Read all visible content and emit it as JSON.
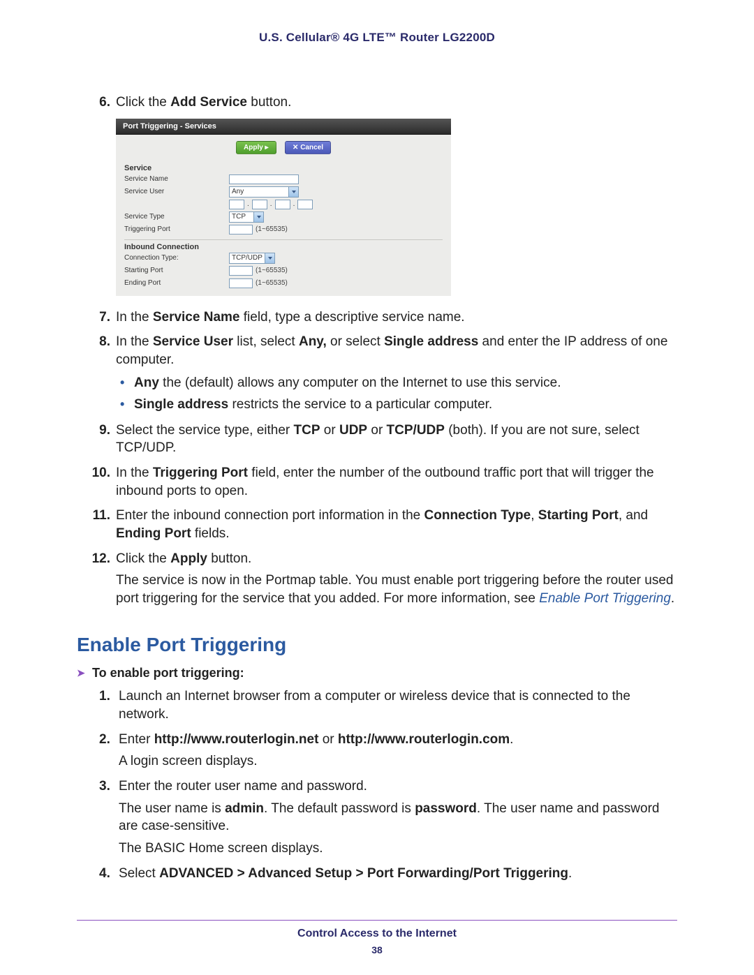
{
  "header": {
    "title": "U.S. Cellular® 4G LTE™ Router LG2200D"
  },
  "steps6to12": {
    "s6": {
      "num": "6.",
      "pre": "Click the ",
      "b": "Add Service",
      "post": " button."
    },
    "s7": {
      "num": "7.",
      "pre": "In the ",
      "b": "Service Name",
      "post": " field, type a descriptive service name."
    },
    "s8": {
      "num": "8.",
      "pre": "In the ",
      "b1": "Service User",
      "mid1": " list, select ",
      "b2": "Any,",
      "mid2": " or select ",
      "b3": "Single address",
      "post": " and enter the IP address of one computer.",
      "bullets": [
        {
          "b": "Any",
          "t": " the (default) allows any computer on the Internet to use this service."
        },
        {
          "b": "Single address",
          "t": " restricts the service to a particular computer."
        }
      ]
    },
    "s9": {
      "num": "9.",
      "pre": "Select the service type, either ",
      "b1": "TCP",
      "mid1": " or ",
      "b2": "UDP",
      "mid2": " or ",
      "b3": "TCP/UDP",
      "post": " (both). If you are not sure, select TCP/UDP."
    },
    "s10": {
      "num": "10.",
      "pre": "In the ",
      "b": "Triggering Port",
      "post": " field, enter the number of the outbound traffic port that will trigger the inbound ports to open."
    },
    "s11": {
      "num": "11.",
      "pre": "Enter the inbound connection port information in the ",
      "b1": "Connection Type",
      "mid1": ", ",
      "b2": "Starting Port",
      "mid2": ", and ",
      "b3": "Ending Port",
      "post": " fields."
    },
    "s12": {
      "num": "12.",
      "pre": "Click the ",
      "b": "Apply",
      "post": " button.",
      "tail_pre": "The service is now in the Portmap table. You must enable port triggering before the router used port triggering for the service that you added. For more information, see ",
      "link": "Enable Port Triggering",
      "tail_post": "."
    }
  },
  "section": {
    "heading": "Enable Port Triggering",
    "lead": "To enable port triggering:"
  },
  "proc": {
    "p1": {
      "num": "1.",
      "t": "Launch an Internet browser from a computer or wireless device that is connected to the network."
    },
    "p2": {
      "num": "2.",
      "pre": "Enter ",
      "b1": "http://www.routerlogin.net",
      "mid": " or ",
      "b2": "http://www.routerlogin.com",
      "post": ".",
      "tail": "A login screen displays."
    },
    "p3": {
      "num": "3.",
      "t": "Enter the router user name and password.",
      "tail_pre": "The user name is ",
      "b1": "admin",
      "tail_mid": ". The default password is ",
      "b2": "password",
      "tail_post": ". The user name and password are case-sensitive.",
      "tail2": "The BASIC Home screen displays."
    },
    "p4": {
      "num": "4.",
      "pre": "Select ",
      "b": "ADVANCED > Advanced Setup > Port Forwarding/Port Triggering",
      "post": "."
    }
  },
  "shot": {
    "title": "Port Triggering - Services",
    "apply": "Apply  ▸",
    "cancel": "✕ Cancel",
    "service_h": "Service",
    "service_name_lbl": "Service Name",
    "service_user_lbl": "Service User",
    "service_user_val": "Any",
    "service_type_lbl": "Service Type",
    "service_type_val": "TCP",
    "trig_port_lbl": "Triggering Port",
    "range_hint": "(1~65535)",
    "inbound_h": "Inbound Connection",
    "conn_type_lbl": "Connection Type:",
    "conn_type_val": "TCP/UDP",
    "start_port_lbl": "Starting Port",
    "end_port_lbl": "Ending Port"
  },
  "footer": {
    "text": "Control Access to the Internet",
    "page": "38"
  }
}
